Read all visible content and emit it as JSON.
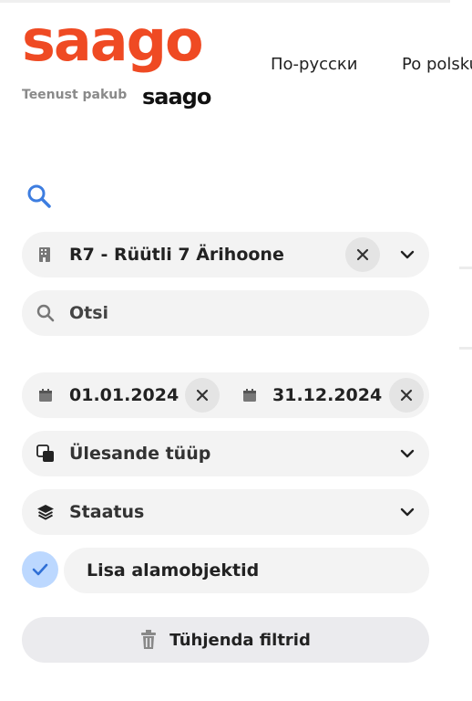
{
  "header": {
    "logo_text": "saago",
    "powered_by": "Teenust pakub",
    "powered_logo_text": "saago",
    "languages": [
      "По-русски",
      "Po polsku"
    ]
  },
  "filters": {
    "object": {
      "value": "R7 - Rüütli 7 Ärihoone",
      "icon": "building-icon"
    },
    "search": {
      "placeholder": "Otsi"
    },
    "date_from": "01.01.2024",
    "date_to": "31.12.2024",
    "task_type": {
      "label": "Ülesande tüüp"
    },
    "status": {
      "label": "Staatus"
    },
    "sub_objects": {
      "label": "Lisa alamobjektid",
      "checked": true
    }
  },
  "actions": {
    "clear_filters": "Tühjenda filtrid"
  },
  "colors": {
    "brand": "#ef4a23",
    "accent": "#3d7de0",
    "check_bg": "#bcd8ff"
  }
}
